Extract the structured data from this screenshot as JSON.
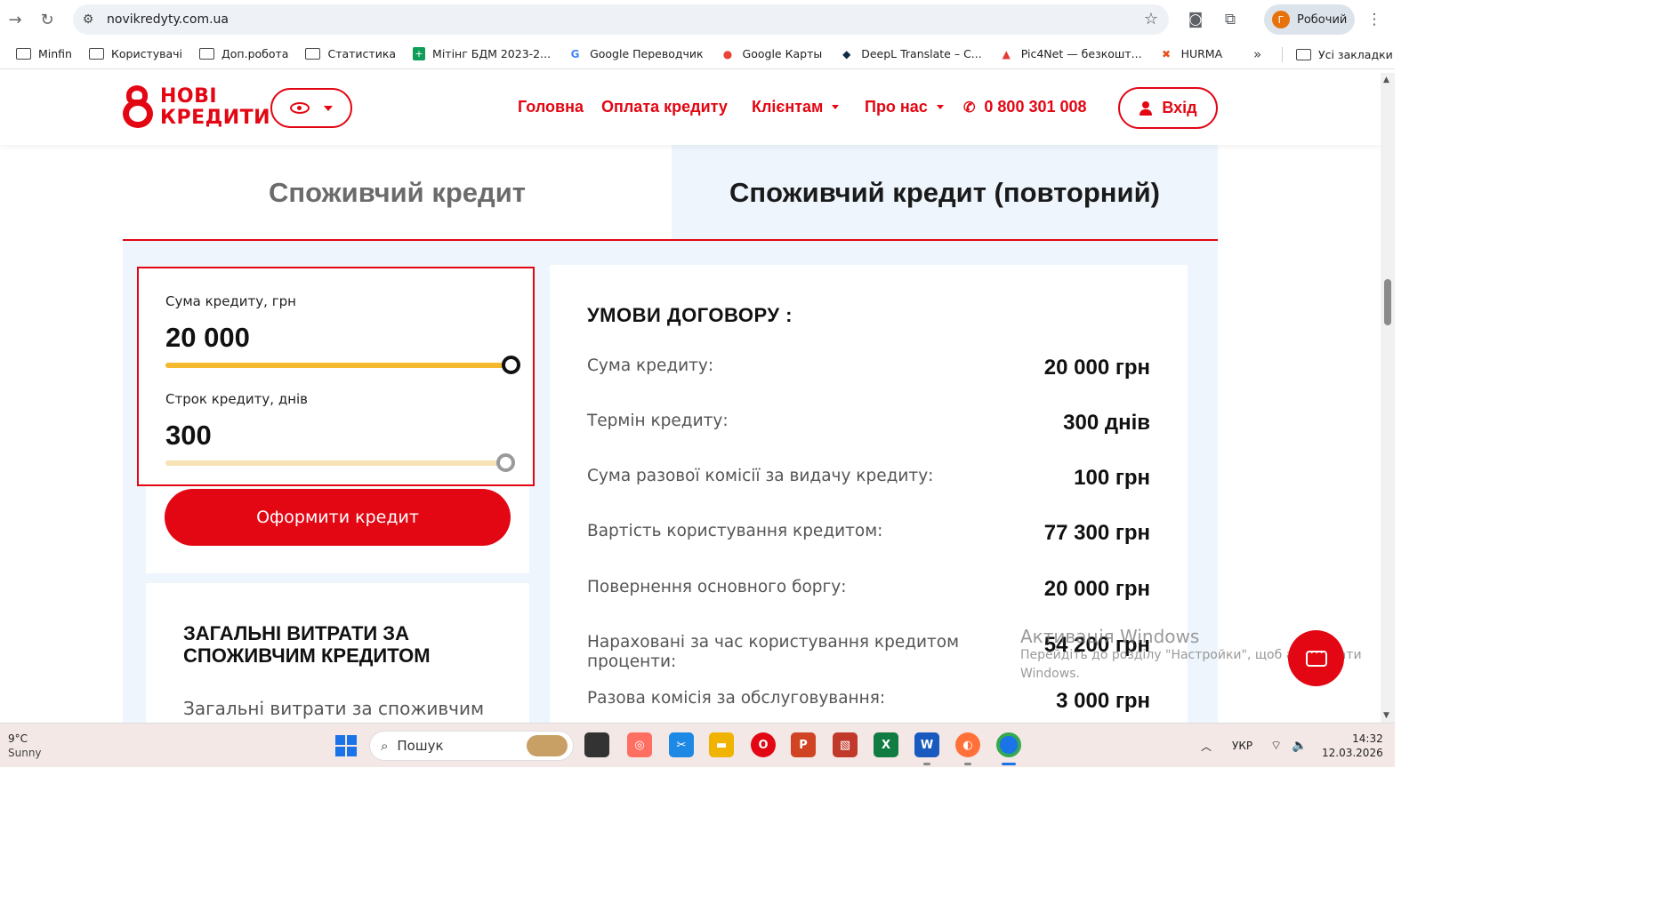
{
  "browser": {
    "url": "novikredyty.com.ua",
    "profile_initial": "Г",
    "profile_name": "Робочий",
    "bookmarks": [
      {
        "label": "Minfin",
        "icon": "folder-icon"
      },
      {
        "label": "Користувачі",
        "icon": "folder-icon"
      },
      {
        "label": "Доп.робота",
        "icon": "folder-icon"
      },
      {
        "label": "Статистика",
        "icon": "folder-icon"
      },
      {
        "label": "Мітінг БДМ 2023-2...",
        "icon": "sheets-icon"
      },
      {
        "label": "Google Переводчик",
        "icon": "translate-icon"
      },
      {
        "label": "Google Карты",
        "icon": "maps-icon"
      },
      {
        "label": "DeepL Translate – C...",
        "icon": "deepl-icon"
      },
      {
        "label": "Pic4Net — безкошт...",
        "icon": "pic4net-icon"
      },
      {
        "label": "HURMA",
        "icon": "hurma-icon"
      }
    ],
    "all_bookmarks": "Усі закладки"
  },
  "header": {
    "logo_line1": "НОВІ",
    "logo_line2": "КРЕДИТИ",
    "nav": {
      "home": "Головна",
      "payment": "Оплата кредиту",
      "clients": "Клієнтам",
      "about": "Про нас",
      "phone": "0 800 301 008"
    },
    "login": "Вхід"
  },
  "tabs": {
    "consumer": "Споживчий кредит",
    "consumer_repeat": "Споживчий кредит (повторний)"
  },
  "calculator": {
    "amount_label": "Сума кредиту, грн",
    "amount_value": "20 000",
    "amount_fill": 1.0,
    "term_label": "Строк кредиту, днів",
    "term_value": "300",
    "term_fill": 1.0,
    "submit": "Оформити кредит"
  },
  "costs": {
    "title": "ЗАГАЛЬНІ ВИТРАТИ ЗА СПОЖИВЧИМ КРЕДИТОМ",
    "text": "Загальні витрати за споживчим кредитом"
  },
  "terms": {
    "title": "УМОВИ ДОГОВОРУ :",
    "rows": [
      {
        "label": "Сума кредиту:",
        "value": "20 000 грн"
      },
      {
        "label": "Термін кредиту:",
        "value": "300 днів"
      },
      {
        "label": "Сума разової комісії за видачу кредиту:",
        "value": "100 грн"
      },
      {
        "label": "Вартість користування кредитом:",
        "value": "77 300 грн"
      },
      {
        "label": "Повернення основного боргу:",
        "value": "20 000 грн"
      },
      {
        "label": "Нараховані за час користування кредитом проценти:",
        "value": "54 200 грн"
      },
      {
        "label": "Разова комісія за обслуговування:",
        "value": "3 000 грн"
      }
    ]
  },
  "windows_activation": {
    "title": "Активація Windows",
    "text": "Перейдіть до розділу \"Настройки\", щоб активувати Windows."
  },
  "taskbar": {
    "temperature": "9°C",
    "condition": "Sunny",
    "search_placeholder": "Пошук",
    "language": "УКР",
    "time": "14:32",
    "date": "12.03.2026"
  },
  "colors": {
    "brand_red": "#e30613",
    "slider_yellow": "#f5b82e",
    "slider_light": "#f7e3b5",
    "panel_bg": "#eef5fc"
  }
}
